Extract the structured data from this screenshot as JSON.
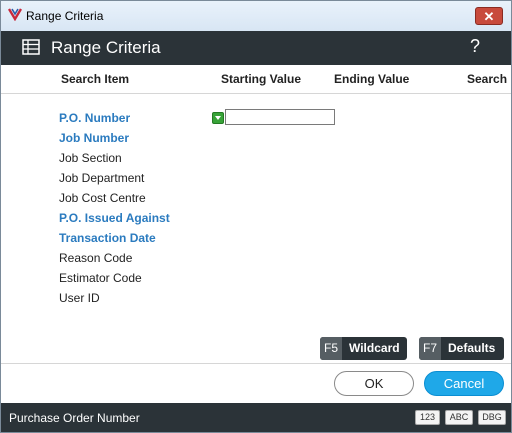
{
  "window": {
    "title": "Range Criteria",
    "close_label": "✕",
    "app_icon": "app-logo-icon"
  },
  "header": {
    "title": "Range Criteria",
    "icon": "table-icon",
    "help_label": "?"
  },
  "columns": {
    "search_item": "Search Item",
    "starting_value": "Starting Value",
    "ending_value": "Ending Value",
    "search": "Search"
  },
  "items": [
    {
      "label": "P.O. Number",
      "highlighted": true
    },
    {
      "label": "Job Number",
      "highlighted": true
    },
    {
      "label": "Job Section",
      "highlighted": false
    },
    {
      "label": "Job Department",
      "highlighted": false
    },
    {
      "label": "Job Cost Centre",
      "highlighted": false
    },
    {
      "label": "P.O. Issued Against",
      "highlighted": true
    },
    {
      "label": "Transaction Date",
      "highlighted": true
    },
    {
      "label": "Reason Code",
      "highlighted": false
    },
    {
      "label": "Estimator Code",
      "highlighted": false
    },
    {
      "label": "User ID",
      "highlighted": false
    }
  ],
  "start_value": {
    "value": "",
    "dropdown_icon": "chevron-down-icon"
  },
  "buttons": {
    "wildcard": {
      "key": "F5",
      "label": "Wildcard"
    },
    "defaults": {
      "key": "F7",
      "label": "Defaults"
    },
    "ok": "OK",
    "cancel": "Cancel"
  },
  "status": {
    "text": "Purchase Order Number",
    "badges": [
      "123",
      "ABC",
      "DBG"
    ]
  },
  "colors": {
    "accent": "#1fa8e8",
    "header_bg": "#2b3338",
    "item_highlight": "#2b7bbf"
  }
}
